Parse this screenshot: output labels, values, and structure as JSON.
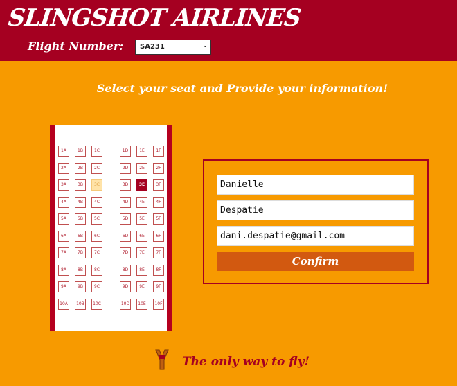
{
  "header": {
    "brand": "SLINGSHOT AIRLINES",
    "flight_label": "Flight Number:",
    "flight_value": "SA231"
  },
  "heading": "Select your seat and Provide your information!",
  "seats": {
    "left_cols": [
      "A",
      "B",
      "C"
    ],
    "right_cols": [
      "D",
      "E",
      "F"
    ],
    "rows": [
      1,
      2,
      3,
      4,
      5,
      6,
      7,
      8,
      9,
      10
    ],
    "unavailable": [
      "3C"
    ],
    "selected": [
      "3E"
    ]
  },
  "form": {
    "first_name": "Danielle",
    "last_name": "Despatie",
    "email": "dani.despatie@gmail.com",
    "confirm_label": "Confirm"
  },
  "footer": {
    "tagline": "The only way to fly!",
    "icon": "slingshot-icon"
  },
  "colors": {
    "background": "#f79a00",
    "brand": "#a50021",
    "button": "#d25910"
  }
}
